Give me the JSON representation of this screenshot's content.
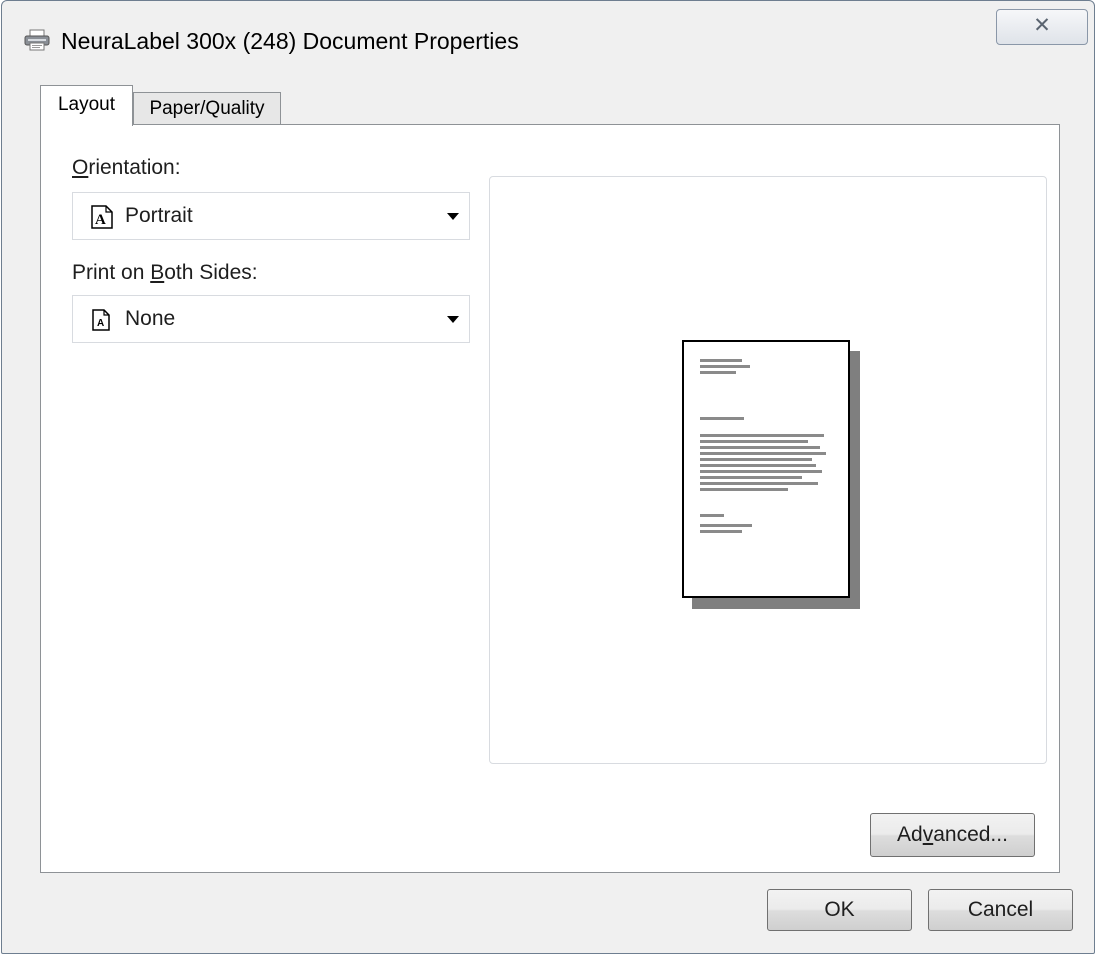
{
  "window": {
    "title": "NeuraLabel 300x (248) Document Properties",
    "close_glyph": "✕",
    "icon": "printer-icon"
  },
  "tabs": [
    {
      "label": "Layout",
      "active": true
    },
    {
      "label": "Paper/Quality",
      "active": false
    }
  ],
  "layout": {
    "orientation": {
      "label_prefix": "",
      "label_mnemonic": "O",
      "label_suffix": "rientation:",
      "value": "Portrait",
      "icon": "portrait-page-icon"
    },
    "duplex": {
      "label_prefix": "Print on ",
      "label_mnemonic": "B",
      "label_suffix": "oth Sides:",
      "value": "None",
      "icon": "single-sided-page-icon"
    },
    "preview": {
      "icon": "document-preview-icon"
    }
  },
  "buttons": {
    "advanced": {
      "prefix": "Ad",
      "mnemonic": "v",
      "suffix": "anced..."
    },
    "ok": "OK",
    "cancel": "Cancel"
  }
}
